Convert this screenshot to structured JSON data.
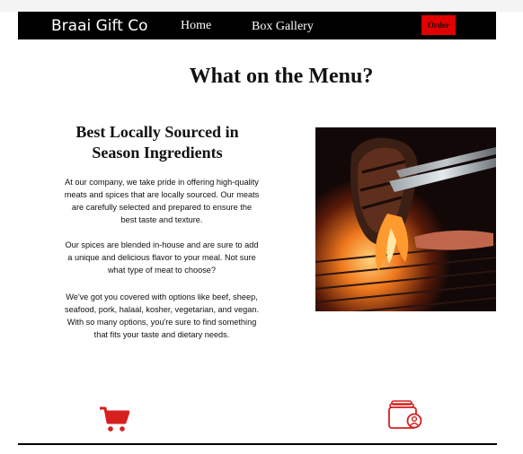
{
  "header": {
    "brand": "Braai Gift Co",
    "nav": [
      "Home",
      "Box Gallery"
    ],
    "order_label": "Order"
  },
  "main": {
    "title": "What on the Menu?",
    "heading": "Best Locally Sourced in Season Ingredients",
    "paragraphs": [
      "At our company, we take pride in offering high-quality meats and spices that are locally sourced. Our meats are carefully selected and prepared to ensure the best taste and texture.",
      "Our spices are blended in-house and are sure to add a unique and delicious flavor to your meal. Not sure what type of meat to choose?",
      "We've got you covered with options like beef, sheep, seafood, pork, halaal, kosher, vegetarian, and vegan. With so many options, you're sure to find something that fits your taste and dietary needs."
    ]
  },
  "icons": {
    "cart": "shopping-cart-icon",
    "account": "wallet-account-icon"
  },
  "colors": {
    "navbar": "#000000",
    "order_button": "#e00000",
    "icon_red": "#d61f1f"
  }
}
